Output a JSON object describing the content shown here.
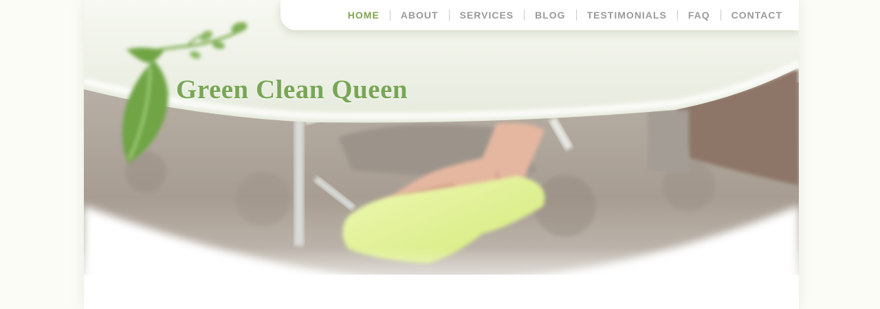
{
  "site": {
    "brand_name": "Green Clean Queen"
  },
  "nav": {
    "items": [
      {
        "label": "HOME",
        "active": true
      },
      {
        "label": "ABOUT",
        "active": false
      },
      {
        "label": "SERVICES",
        "active": false
      },
      {
        "label": "BLOG",
        "active": false
      },
      {
        "label": "TESTIMONIALS",
        "active": false
      },
      {
        "label": "FAQ",
        "active": false
      },
      {
        "label": "CONTACT",
        "active": false
      }
    ]
  },
  "hero": {
    "image_icon": "cleaning-hand-icon",
    "logo_icon": "leaf-logo-icon"
  },
  "colors": {
    "brand_green": "#79a655",
    "nav_active": "#7ea552",
    "nav_inactive": "#9a9a98",
    "page_background": "#fbfcf6"
  }
}
